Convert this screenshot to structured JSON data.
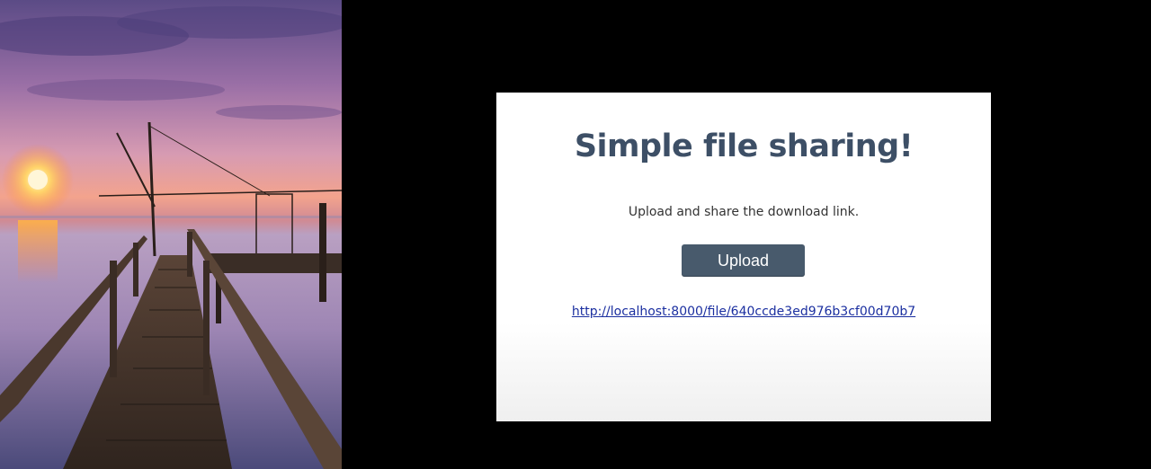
{
  "card": {
    "title": "Simple file sharing!",
    "subtitle": "Upload and share the download link.",
    "upload_label": "Upload",
    "link_text": "http://localhost:8000/file/640ccde3ed976b3cf00d70b7"
  },
  "colors": {
    "background": "#000000",
    "card_background": "#ffffff",
    "title": "#3d4f66",
    "button": "#485a6c",
    "link": "#1b2fa0"
  }
}
